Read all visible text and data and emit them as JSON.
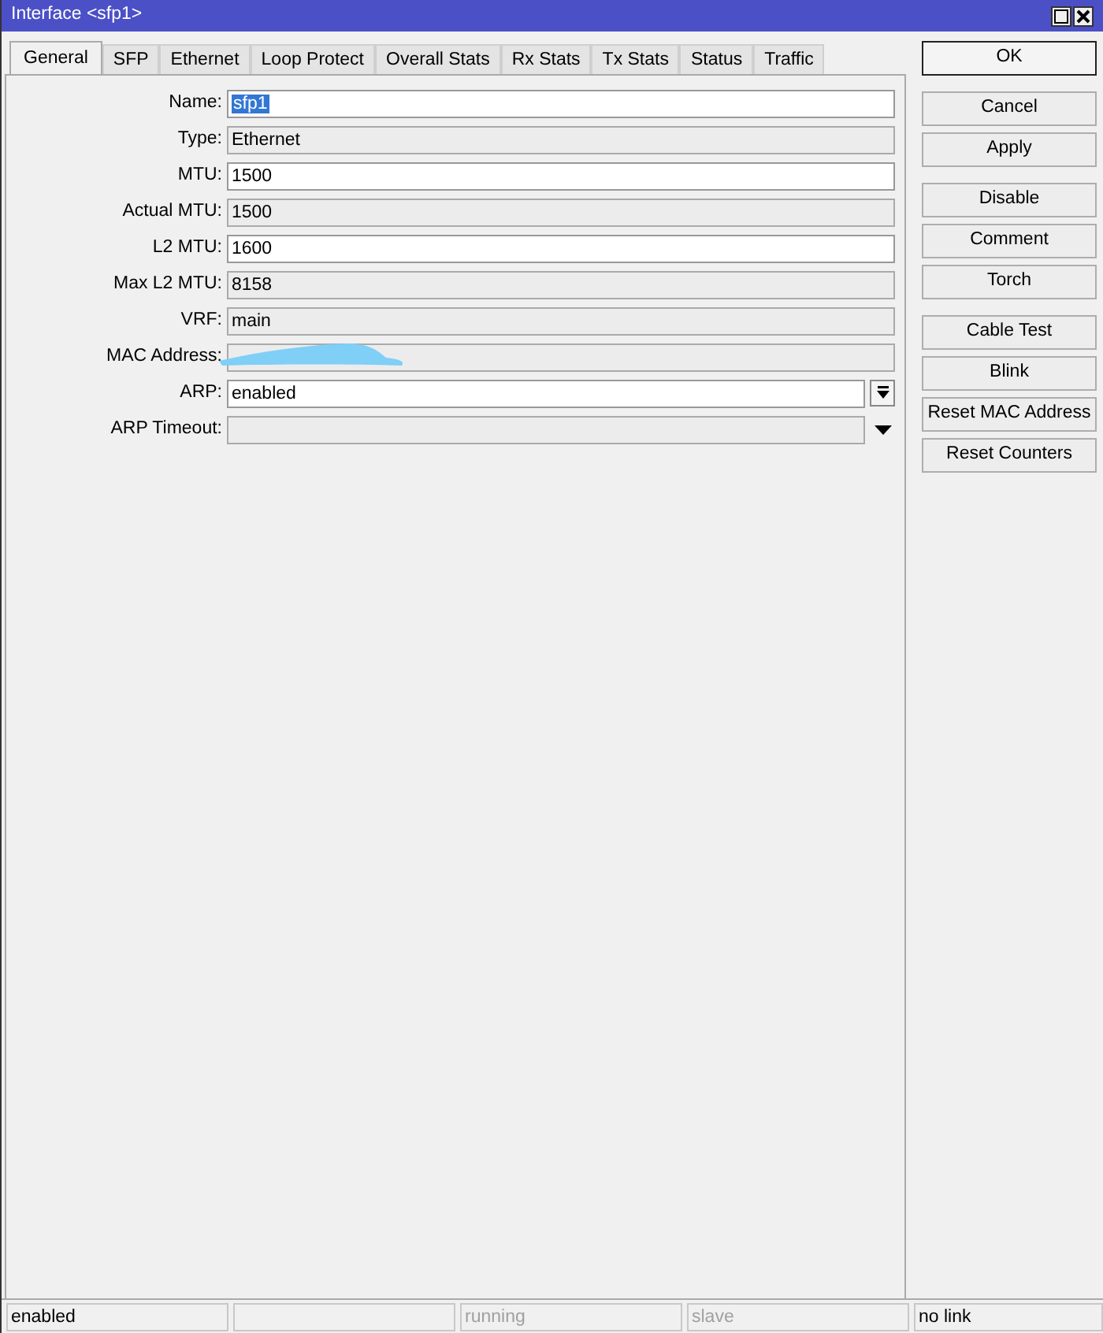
{
  "window": {
    "title": "Interface <sfp1>"
  },
  "tabs": [
    {
      "label": "General",
      "selected": true
    },
    {
      "label": "SFP",
      "selected": false
    },
    {
      "label": "Ethernet",
      "selected": false
    },
    {
      "label": "Loop Protect",
      "selected": false
    },
    {
      "label": "Overall Stats",
      "selected": false
    },
    {
      "label": "Rx Stats",
      "selected": false
    },
    {
      "label": "Tx Stats",
      "selected": false
    },
    {
      "label": "Status",
      "selected": false
    },
    {
      "label": "Traffic",
      "selected": false
    }
  ],
  "fields": [
    {
      "label": "Name:",
      "value": "sfp1",
      "kind": "editable",
      "selected": true
    },
    {
      "label": "Type:",
      "value": "Ethernet",
      "kind": "readonly",
      "selected": false
    },
    {
      "label": "MTU:",
      "value": "1500",
      "kind": "editable",
      "selected": false
    },
    {
      "label": "Actual MTU:",
      "value": "1500",
      "kind": "readonly",
      "selected": false
    },
    {
      "label": "L2 MTU:",
      "value": "1600",
      "kind": "editable",
      "selected": false
    },
    {
      "label": "Max L2 MTU:",
      "value": "8158",
      "kind": "readonly",
      "selected": false
    },
    {
      "label": "VRF:",
      "value": "main",
      "kind": "readonly",
      "selected": false
    },
    {
      "label": "MAC Address:",
      "kind": "redacted"
    },
    {
      "label": "ARP:",
      "value": "enabled",
      "kind": "dropdown",
      "selected": false
    },
    {
      "label": "ARP Timeout:",
      "kind": "optional"
    }
  ],
  "button_groups": [
    [
      {
        "label": "OK",
        "default": true
      }
    ],
    [
      {
        "label": "Cancel",
        "default": false
      },
      {
        "label": "Apply",
        "default": false
      }
    ],
    [
      {
        "label": "Disable",
        "default": false
      },
      {
        "label": "Comment",
        "default": false
      },
      {
        "label": "Torch",
        "default": false
      }
    ],
    [
      {
        "label": "Cable Test",
        "default": false
      },
      {
        "label": "Blink",
        "default": false
      },
      {
        "label": "Reset MAC Address",
        "default": false
      },
      {
        "label": "Reset Counters",
        "default": false
      }
    ]
  ],
  "status_bar": [
    {
      "kind": "text",
      "text": "enabled",
      "disabled": false
    },
    {
      "kind": "empty"
    },
    {
      "kind": "text",
      "text": "running",
      "disabled": true
    },
    {
      "kind": "text",
      "text": "slave",
      "disabled": true
    },
    {
      "kind": "text",
      "text": "no link",
      "disabled": false
    }
  ]
}
